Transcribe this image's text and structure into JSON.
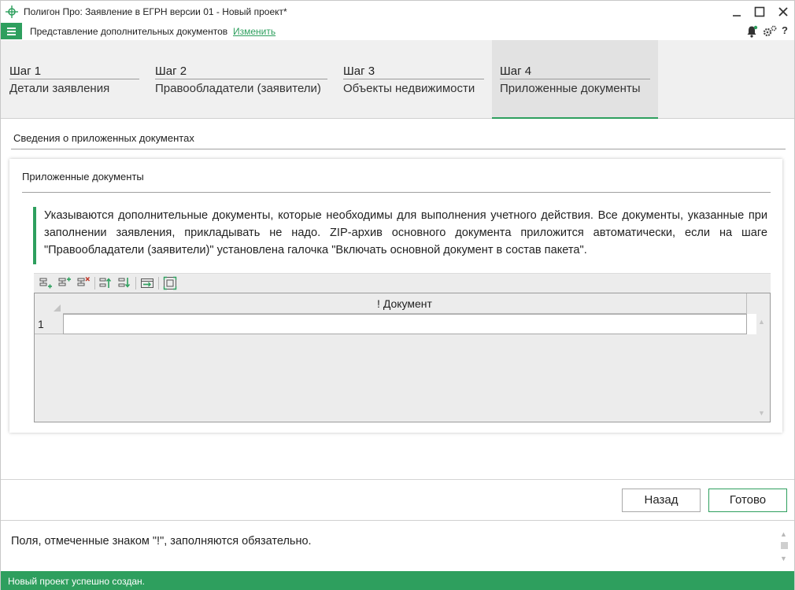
{
  "window": {
    "title": "Полигон Про: Заявление в ЕГРН версии 01 - Новый проект*"
  },
  "menubar": {
    "view_label": "Представление дополнительных документов",
    "change_link": "Изменить"
  },
  "steps": [
    {
      "num": "Шаг 1",
      "name": "Детали заявления"
    },
    {
      "num": "Шаг 2",
      "name": "Правообладатели (заявители)"
    },
    {
      "num": "Шаг 3",
      "name": "Объекты недвижимости"
    },
    {
      "num": "Шаг 4",
      "name": "Приложенные документы"
    }
  ],
  "active_step": 4,
  "section": {
    "title": "Сведения о приложенных документах"
  },
  "panel": {
    "title": "Приложенные документы",
    "note": "Указываются дополнительные документы, которые необходимы для выполнения учетного действия. Все документы, указанные при заполнении заявления, прикладывать не надо. ZIP-архив основного документа приложится автоматически, если на шаге \"Правообладатели (заявители)\" установлена галочка \"Включать основной документ в состав пакета\"."
  },
  "grid": {
    "column_header": "! Документ",
    "rows": [
      {
        "num": "1",
        "value": ""
      }
    ]
  },
  "buttons": {
    "back": "Назад",
    "done": "Готово"
  },
  "info": {
    "text": "Поля, отмеченные знаком \"!\", заполняются обязательно."
  },
  "status": {
    "text": "Новый проект успешно создан."
  },
  "colors": {
    "accent": "#2e9f5e"
  }
}
